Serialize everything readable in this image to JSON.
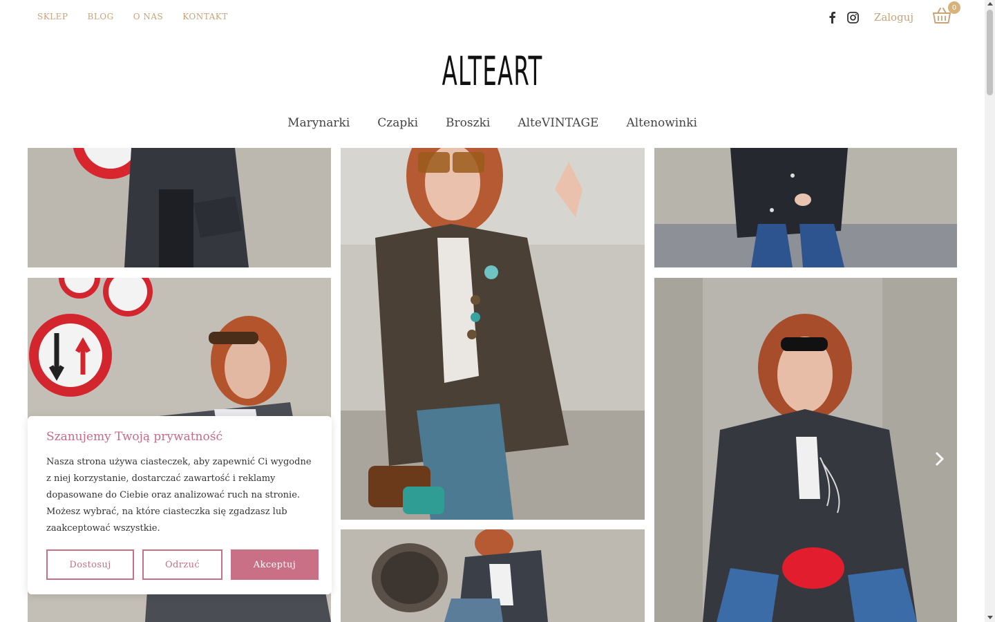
{
  "top_nav": {
    "items": [
      "SKLEP",
      "BLOG",
      "O NAS",
      "KONTAKT"
    ]
  },
  "account": {
    "login_label": "Zaloguj"
  },
  "cart": {
    "count": "0"
  },
  "brand": {
    "logo_text": "ALTEART"
  },
  "main_nav": {
    "items": [
      "Marynarki",
      "Czapki",
      "Broszki",
      "AlteVINTAGE",
      "Altenowinki"
    ]
  },
  "icons": {
    "facebook": "facebook-icon",
    "instagram": "instagram-icon",
    "cart": "basket-icon",
    "next": "chevron-right-icon"
  },
  "colors": {
    "accent_gold": "#c9a27a",
    "accent_pink": "#c96f86",
    "text": "#333333"
  },
  "cookie_banner": {
    "title": "Szanujemy Twoją prywatność",
    "body": "Nasza strona używa ciasteczek, aby zapewnić Ci wygodne z niej korzystanie, dostarczać zawartość i reklamy dopasowane do Ciebie oraz analizować ruch na stronie. Możesz wybrać, na które ciasteczka się zgadzasz lub zaakceptować wszystkie.",
    "customize_label": "Dostosuj",
    "reject_label": "Odrzuć",
    "accept_label": "Akceptuj"
  }
}
